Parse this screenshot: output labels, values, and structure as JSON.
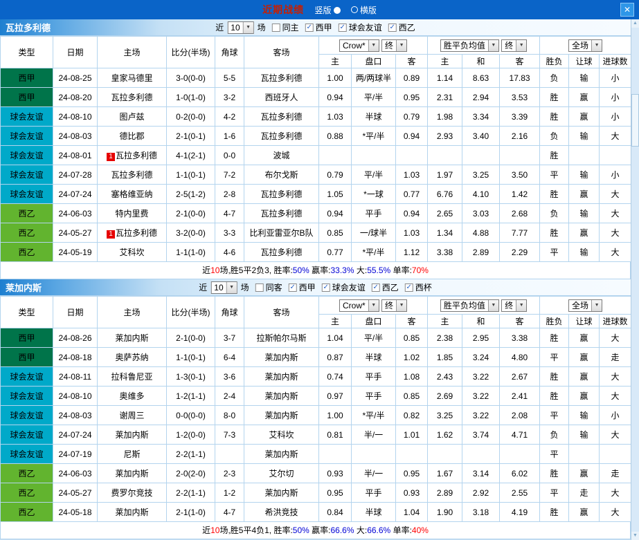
{
  "header": {
    "title": "近期战绩",
    "vertical_label": "竖版",
    "horizontal_label": "横版",
    "close_label": "✕"
  },
  "colors": {
    "titlebar_bg": "#0a64c8",
    "title_text": "#c81e00",
    "laliga_badge": "#00744a",
    "friendly_badge": "#00a9c9",
    "segunda_badge": "#62b42f",
    "win_red": "#ff0000",
    "lose_green": "#009900",
    "value_blue": "#0000d5",
    "push_teal": "#00a0a0"
  },
  "sections": [
    {
      "team": "瓦拉多利德",
      "near": "近",
      "count": "10",
      "games": "场",
      "checkboxes": [
        {
          "label": "同主",
          "checked": false
        },
        {
          "label": "西甲",
          "checked": true
        },
        {
          "label": "球会友谊",
          "checked": true
        },
        {
          "label": "西乙",
          "checked": true
        }
      ],
      "company_select": "Crow*",
      "final1": "终",
      "avg_select": "胜平负均值",
      "final2": "终",
      "scope_select": "全场",
      "col_headers": {
        "type": "类型",
        "date": "日期",
        "home": "主场",
        "score": "比分(半场)",
        "corner": "角球",
        "away": "客场",
        "o_home": "主",
        "o_handicap": "盘口",
        "o_away": "客",
        "a_home": "主",
        "a_draw": "和",
        "a_away": "客",
        "result": "胜负",
        "handi": "让球",
        "goals": "进球数"
      },
      "rows": [
        {
          "type": "西甲",
          "tcls": "jia",
          "date": "24-08-25",
          "home": "皇家马德里",
          "homeCls": "k",
          "badge": "",
          "score": "3-0(0-0)",
          "scoreCls": "r",
          "corner": "5-5",
          "away": "瓦拉多利德",
          "awayCls": "g",
          "oh": "1.00",
          "hc": "两/两球半",
          "hcCls": "k",
          "oa": "0.89",
          "ah": "1.14",
          "ad": "8.63",
          "aa": "17.83",
          "res": "负",
          "resCls": "g",
          "let": "输",
          "letCls": "g",
          "big": "小",
          "bigCls": "g"
        },
        {
          "type": "西甲",
          "tcls": "jia",
          "date": "24-08-20",
          "home": "瓦拉多利德",
          "homeCls": "g",
          "badge": "",
          "score": "1-0(1-0)",
          "scoreCls": "r",
          "corner": "3-2",
          "away": "西班牙人",
          "awayCls": "k",
          "oh": "0.94",
          "hc": "平/半",
          "hcCls": "k",
          "oa": "0.95",
          "ah": "2.31",
          "ad": "2.94",
          "aa": "3.53",
          "res": "胜",
          "resCls": "r",
          "let": "赢",
          "letCls": "r",
          "big": "小",
          "bigCls": "g"
        },
        {
          "type": "球会友谊",
          "tcls": "you",
          "date": "24-08-10",
          "home": "图卢兹",
          "homeCls": "k",
          "badge": "",
          "score": "0-2(0-0)",
          "scoreCls": "r",
          "corner": "4-2",
          "away": "瓦拉多利德",
          "awayCls": "g",
          "oh": "1.03",
          "hc": "半球",
          "hcCls": "k",
          "oa": "0.79",
          "ah": "1.98",
          "ad": "3.34",
          "aa": "3.39",
          "res": "胜",
          "resCls": "r",
          "let": "赢",
          "letCls": "r",
          "big": "小",
          "bigCls": "g"
        },
        {
          "type": "球会友谊",
          "tcls": "you",
          "date": "24-08-03",
          "home": "德比郡",
          "homeCls": "k",
          "badge": "",
          "score": "2-1(0-1)",
          "scoreCls": "r",
          "corner": "1-6",
          "away": "瓦拉多利德",
          "awayCls": "g",
          "oh": "0.88",
          "hc": "*平/半",
          "hcCls": "r",
          "oa": "0.94",
          "ah": "2.93",
          "ad": "3.40",
          "aa": "2.16",
          "res": "负",
          "resCls": "g",
          "let": "输",
          "letCls": "g",
          "big": "大",
          "bigCls": "r"
        },
        {
          "type": "球会友谊",
          "tcls": "you",
          "date": "24-08-01",
          "home": "瓦拉多利德",
          "homeCls": "g",
          "badge": "1",
          "score": "4-1(2-1)",
          "scoreCls": "r",
          "corner": "0-0",
          "away": "波城",
          "awayCls": "k",
          "oh": "",
          "hc": "",
          "hcCls": "k",
          "oa": "",
          "ah": "",
          "ad": "",
          "aa": "",
          "res": "胜",
          "resCls": "r",
          "let": "",
          "letCls": "k",
          "big": "",
          "bigCls": "k"
        },
        {
          "type": "球会友谊",
          "tcls": "you",
          "date": "24-07-28",
          "home": "瓦拉多利德",
          "homeCls": "g",
          "badge": "",
          "score": "1-1(0-1)",
          "scoreCls": "r",
          "corner": "7-2",
          "away": "布尔戈斯",
          "awayCls": "k",
          "oh": "0.79",
          "hc": "平/半",
          "hcCls": "k",
          "oa": "1.03",
          "ah": "1.97",
          "ad": "3.25",
          "aa": "3.50",
          "res": "平",
          "resCls": "k",
          "let": "输",
          "letCls": "g",
          "big": "小",
          "bigCls": "g"
        },
        {
          "type": "球会友谊",
          "tcls": "you",
          "date": "24-07-24",
          "home": "塞格维亚纳",
          "homeCls": "k",
          "badge": "",
          "score": "2-5(1-2)",
          "scoreCls": "r",
          "corner": "2-8",
          "away": "瓦拉多利德",
          "awayCls": "g",
          "oh": "1.05",
          "hc": "*一球",
          "hcCls": "r",
          "oa": "0.77",
          "ah": "6.76",
          "ad": "4.10",
          "aa": "1.42",
          "res": "胜",
          "resCls": "r",
          "let": "赢",
          "letCls": "r",
          "big": "大",
          "bigCls": "r"
        },
        {
          "type": "西乙",
          "tcls": "yi",
          "date": "24-06-03",
          "home": "特内里费",
          "homeCls": "k",
          "badge": "",
          "score": "2-1(0-0)",
          "scoreCls": "r",
          "corner": "4-7",
          "away": "瓦拉多利德",
          "awayCls": "g",
          "oh": "0.94",
          "hc": "平手",
          "hcCls": "k",
          "oa": "0.94",
          "ah": "2.65",
          "ad": "3.03",
          "aa": "2.68",
          "res": "负",
          "resCls": "g",
          "let": "输",
          "letCls": "g",
          "big": "大",
          "bigCls": "r"
        },
        {
          "type": "西乙",
          "tcls": "yi",
          "date": "24-05-27",
          "home": "瓦拉多利德",
          "homeCls": "g",
          "badge": "1",
          "score": "3-2(0-0)",
          "scoreCls": "r",
          "corner": "3-3",
          "away": "比利亚雷亚尔B队",
          "awayCls": "k",
          "oh": "0.85",
          "hc": "一/球半",
          "hcCls": "r",
          "oa": "1.03",
          "ah": "1.34",
          "ad": "4.88",
          "aa": "7.77",
          "res": "胜",
          "resCls": "r",
          "let": "赢",
          "letCls": "r",
          "big": "大",
          "bigCls": "r"
        },
        {
          "type": "西乙",
          "tcls": "yi",
          "date": "24-05-19",
          "home": "艾科坎",
          "homeCls": "k",
          "badge": "",
          "score": "1-1(1-0)",
          "scoreCls": "r",
          "corner": "4-6",
          "away": "瓦拉多利德",
          "awayCls": "g",
          "oh": "0.77",
          "hc": "*平/半",
          "hcCls": "r",
          "oa": "1.12",
          "ah": "3.38",
          "ad": "2.89",
          "aa": "2.29",
          "res": "平",
          "resCls": "k",
          "let": "输",
          "letCls": "g",
          "big": "大",
          "bigCls": "r"
        }
      ],
      "summary": [
        {
          "t": "近",
          "c": "k"
        },
        {
          "t": "10",
          "c": "r"
        },
        {
          "t": "场,胜5平2负3, 胜率:",
          "c": "k"
        },
        {
          "t": "50%",
          "c": "b"
        },
        {
          "t": " 赢率:",
          "c": "k"
        },
        {
          "t": "33.3%",
          "c": "b"
        },
        {
          "t": " 大:",
          "c": "k"
        },
        {
          "t": "55.5%",
          "c": "b"
        },
        {
          "t": " 单率:",
          "c": "k"
        },
        {
          "t": "70%",
          "c": "r"
        }
      ]
    },
    {
      "team": "莱加内斯",
      "near": "近",
      "count": "10",
      "games": "场",
      "checkboxes": [
        {
          "label": "同客",
          "checked": false
        },
        {
          "label": "西甲",
          "checked": true
        },
        {
          "label": "球会友谊",
          "checked": true
        },
        {
          "label": "西乙",
          "checked": true
        },
        {
          "label": "西杯",
          "checked": true
        }
      ],
      "company_select": "Crow*",
      "final1": "终",
      "avg_select": "胜平负均值",
      "final2": "终",
      "scope_select": "全场",
      "col_headers": {
        "type": "类型",
        "date": "日期",
        "home": "主场",
        "score": "比分(半场)",
        "corner": "角球",
        "away": "客场",
        "o_home": "主",
        "o_handicap": "盘口",
        "o_away": "客",
        "a_home": "主",
        "a_draw": "和",
        "a_away": "客",
        "result": "胜负",
        "handi": "让球",
        "goals": "进球数"
      },
      "rows": [
        {
          "type": "西甲",
          "tcls": "jia",
          "date": "24-08-26",
          "home": "莱加内斯",
          "homeCls": "g",
          "badge": "",
          "score": "2-1(0-0)",
          "scoreCls": "r",
          "corner": "3-7",
          "away": "拉斯帕尔马斯",
          "awayCls": "k",
          "oh": "1.04",
          "hc": "平/半",
          "hcCls": "k",
          "oa": "0.85",
          "ah": "2.38",
          "ad": "2.95",
          "aa": "3.38",
          "res": "胜",
          "resCls": "r",
          "let": "赢",
          "letCls": "r",
          "big": "大",
          "bigCls": "r"
        },
        {
          "type": "西甲",
          "tcls": "jia",
          "date": "24-08-18",
          "home": "奥萨苏纳",
          "homeCls": "k",
          "badge": "",
          "score": "1-1(0-1)",
          "scoreCls": "r",
          "corner": "6-4",
          "away": "莱加内斯",
          "awayCls": "g",
          "oh": "0.87",
          "hc": "半球",
          "hcCls": "k",
          "oa": "1.02",
          "ah": "1.85",
          "ad": "3.24",
          "aa": "4.80",
          "res": "平",
          "resCls": "k",
          "let": "赢",
          "letCls": "r",
          "big": "走",
          "bigCls": "t"
        },
        {
          "type": "球会友谊",
          "tcls": "you",
          "date": "24-08-11",
          "home": "拉科鲁尼亚",
          "homeCls": "k",
          "badge": "",
          "score": "1-3(0-1)",
          "scoreCls": "r",
          "corner": "3-6",
          "away": "莱加内斯",
          "awayCls": "g",
          "oh": "0.74",
          "hc": "平手",
          "hcCls": "k",
          "oa": "1.08",
          "ah": "2.43",
          "ad": "3.22",
          "aa": "2.67",
          "res": "胜",
          "resCls": "r",
          "let": "赢",
          "letCls": "r",
          "big": "大",
          "bigCls": "r"
        },
        {
          "type": "球会友谊",
          "tcls": "you",
          "date": "24-08-10",
          "home": "奥维多",
          "homeCls": "k",
          "badge": "",
          "score": "1-2(1-1)",
          "scoreCls": "r",
          "corner": "2-4",
          "away": "莱加内斯",
          "awayCls": "g",
          "oh": "0.97",
          "hc": "平手",
          "hcCls": "k",
          "oa": "0.85",
          "ah": "2.69",
          "ad": "3.22",
          "aa": "2.41",
          "res": "胜",
          "resCls": "r",
          "let": "赢",
          "letCls": "r",
          "big": "大",
          "bigCls": "r"
        },
        {
          "type": "球会友谊",
          "tcls": "you",
          "date": "24-08-03",
          "home": "谢周三",
          "homeCls": "k",
          "badge": "",
          "score": "0-0(0-0)",
          "scoreCls": "b",
          "corner": "8-0",
          "away": "莱加内斯",
          "awayCls": "g",
          "oh": "1.00",
          "hc": "*平/半",
          "hcCls": "r",
          "oa": "0.82",
          "ah": "3.25",
          "ad": "3.22",
          "aa": "2.08",
          "res": "平",
          "resCls": "k",
          "let": "输",
          "letCls": "g",
          "big": "小",
          "bigCls": "g"
        },
        {
          "type": "球会友谊",
          "tcls": "you",
          "date": "24-07-24",
          "home": "莱加内斯",
          "homeCls": "g",
          "badge": "",
          "score": "1-2(0-0)",
          "scoreCls": "r",
          "corner": "7-3",
          "away": "艾科坎",
          "awayCls": "k",
          "oh": "0.81",
          "hc": "半/一",
          "hcCls": "k",
          "oa": "1.01",
          "ah": "1.62",
          "ad": "3.74",
          "aa": "4.71",
          "res": "负",
          "resCls": "g",
          "let": "输",
          "letCls": "g",
          "big": "大",
          "bigCls": "r"
        },
        {
          "type": "球会友谊",
          "tcls": "you",
          "date": "24-07-19",
          "home": "尼斯",
          "homeCls": "k",
          "badge": "",
          "score": "2-2(1-1)",
          "scoreCls": "r",
          "corner": "",
          "away": "莱加内斯",
          "awayCls": "g",
          "oh": "",
          "hc": "",
          "hcCls": "k",
          "oa": "",
          "ah": "",
          "ad": "",
          "aa": "",
          "res": "平",
          "resCls": "k",
          "let": "",
          "letCls": "k",
          "big": "",
          "bigCls": "k"
        },
        {
          "type": "西乙",
          "tcls": "yi",
          "date": "24-06-03",
          "home": "莱加内斯",
          "homeCls": "g",
          "badge": "",
          "score": "2-0(2-0)",
          "scoreCls": "r",
          "corner": "2-3",
          "away": "艾尔切",
          "awayCls": "k",
          "oh": "0.93",
          "hc": "半/一",
          "hcCls": "k",
          "oa": "0.95",
          "ah": "1.67",
          "ad": "3.14",
          "aa": "6.02",
          "res": "胜",
          "resCls": "r",
          "let": "赢",
          "letCls": "r",
          "big": "走",
          "bigCls": "t"
        },
        {
          "type": "西乙",
          "tcls": "yi",
          "date": "24-05-27",
          "home": "费罗尔竞技",
          "homeCls": "k",
          "badge": "",
          "score": "2-2(1-1)",
          "scoreCls": "r",
          "corner": "1-2",
          "away": "莱加内斯",
          "awayCls": "g",
          "oh": "0.95",
          "hc": "平手",
          "hcCls": "k",
          "oa": "0.93",
          "ah": "2.89",
          "ad": "2.92",
          "aa": "2.55",
          "res": "平",
          "resCls": "k",
          "let": "走",
          "letCls": "t",
          "big": "大",
          "bigCls": "r"
        },
        {
          "type": "西乙",
          "tcls": "yi",
          "date": "24-05-18",
          "home": "莱加内斯",
          "homeCls": "g",
          "badge": "",
          "score": "2-1(1-0)",
          "scoreCls": "r",
          "corner": "4-7",
          "away": "希洪竞技",
          "awayCls": "k",
          "oh": "0.84",
          "hc": "半球",
          "hcCls": "k",
          "oa": "1.04",
          "ah": "1.90",
          "ad": "3.18",
          "aa": "4.19",
          "res": "胜",
          "resCls": "r",
          "let": "赢",
          "letCls": "r",
          "big": "大",
          "bigCls": "r"
        }
      ],
      "summary": [
        {
          "t": "近",
          "c": "k"
        },
        {
          "t": "10",
          "c": "r"
        },
        {
          "t": "场,胜5平4负1, 胜率:",
          "c": "k"
        },
        {
          "t": "50%",
          "c": "b"
        },
        {
          "t": " 赢率:",
          "c": "k"
        },
        {
          "t": "66.6%",
          "c": "b"
        },
        {
          "t": " 大:",
          "c": "k"
        },
        {
          "t": "66.6%",
          "c": "b"
        },
        {
          "t": " 单率:",
          "c": "k"
        },
        {
          "t": "40%",
          "c": "r"
        }
      ]
    }
  ]
}
